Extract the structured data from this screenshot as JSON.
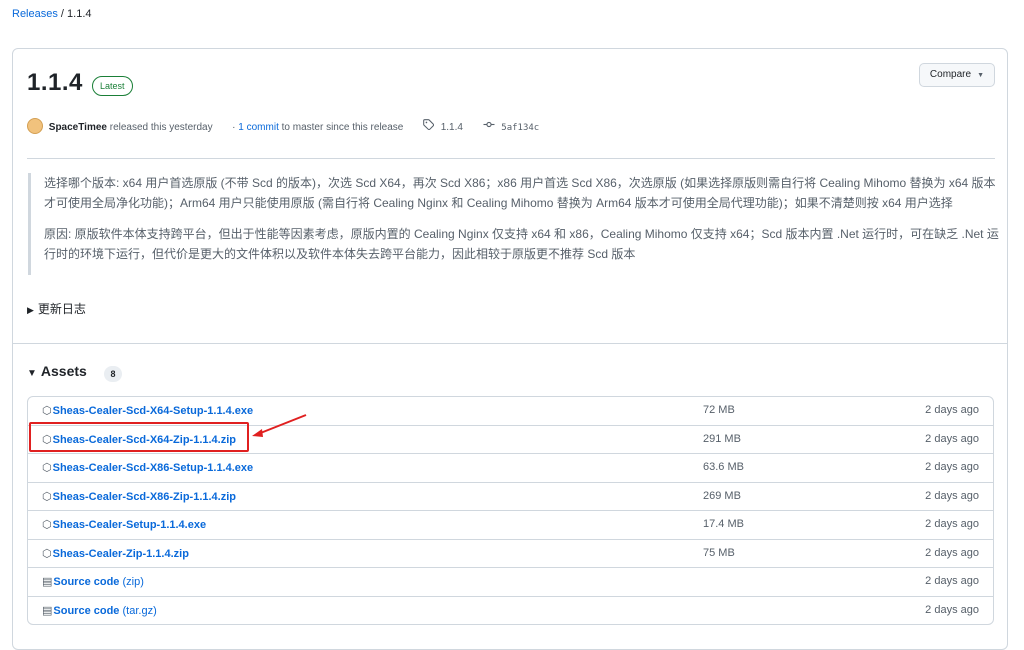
{
  "breadcrumb": {
    "root": "Releases",
    "separator": "/",
    "current": "1.1.4"
  },
  "release": {
    "version": "1.1.4",
    "badge": "Latest",
    "compare_label": "Compare",
    "author": "SpaceTimee",
    "released_text": "released this yesterday",
    "commits_prefix": "·",
    "commits_link": "1 commit",
    "commits_suffix": "to master since this release",
    "tag": "1.1.4",
    "commit_sha": "5af134c"
  },
  "notes": {
    "paragraph1": "选择哪个版本: x64 用户首选原版 (不带 Scd 的版本)，次选 Scd X64，再次 Scd X86；x86 用户首选 Scd X86，次选原版 (如果选择原版则需自行将 Cealing Mihomo 替换为 x64 版本才可使用全局净化功能)；Arm64 用户只能使用原版 (需自行将 Cealing Nginx 和 Cealing Mihomo 替换为 Arm64 版本才可使用全局代理功能)；如果不清楚则按 x64 用户选择",
    "paragraph2": "原因: 原版软件本体支持跨平台，但出于性能等因素考虑，原版内置的 Cealing Nginx 仅支持 x64 和 x86，Cealing Mihomo 仅支持 x64；Scd 版本内置 .Net 运行时，可在缺乏 .Net 运行时的环境下运行，但代价是更大的文件体积以及软件本体失去跨平台能力，因此相较于原版更不推荐 Scd 版本"
  },
  "changelog_label": "更新日志",
  "assets": {
    "title": "Assets",
    "count": "8",
    "rows": [
      {
        "name": "Sheas-Cealer-Scd-X64-Setup-1.1.4.exe",
        "suffix": "",
        "size": "72 MB",
        "date": "2 days ago"
      },
      {
        "name": "Sheas-Cealer-Scd-X64-Zip-1.1.4.zip",
        "suffix": "",
        "size": "291 MB",
        "date": "2 days ago"
      },
      {
        "name": "Sheas-Cealer-Scd-X86-Setup-1.1.4.exe",
        "suffix": "",
        "size": "63.6 MB",
        "date": "2 days ago"
      },
      {
        "name": "Sheas-Cealer-Scd-X86-Zip-1.1.4.zip",
        "suffix": "",
        "size": "269 MB",
        "date": "2 days ago"
      },
      {
        "name": "Sheas-Cealer-Setup-1.1.4.exe",
        "suffix": "",
        "size": "17.4 MB",
        "date": "2 days ago"
      },
      {
        "name": "Sheas-Cealer-Zip-1.1.4.zip",
        "suffix": "",
        "size": "75 MB",
        "date": "2 days ago"
      },
      {
        "name": "Source code",
        "suffix": "(zip)",
        "size": "",
        "date": "2 days ago"
      },
      {
        "name": "Source code",
        "suffix": "(tar.gz)",
        "size": "",
        "date": "2 days ago"
      }
    ]
  },
  "icons": {
    "package": "package-icon",
    "file_zip": "file-zip-icon",
    "tag": "tag-icon",
    "commit": "git-commit-icon",
    "caret": "triangle-down-icon"
  },
  "colors": {
    "link": "#0969da",
    "latest": "#1a7f37",
    "highlight": "#e02020"
  }
}
